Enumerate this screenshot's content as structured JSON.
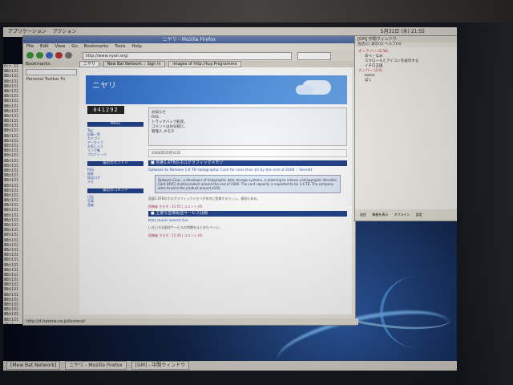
{
  "desktop": {
    "top_menu": [
      "アプリケーション",
      "アクション"
    ],
    "clock": "5月31日 (水) 21:55",
    "taskbar_items": [
      "[Mew Bat Network]",
      "ニヤリ - Mozilla Firefox",
      "[GM] - 中間ウィンドウ"
    ]
  },
  "log_lines": [
    "Oct-31 15:1",
    "Oct-31 15:1",
    "Oct-31 15:1",
    "Oct-31 15:1",
    "Oct-31 15:1",
    "Oct-31 15:1",
    "Oct-31 15:1",
    "Oct-31 15:1",
    "Oct-31 15:1",
    "Oct-31 15:1",
    "Oct-31 15:1",
    "Oct-31 15:1",
    "Oct-31 15:1",
    "Oct-31 15:1",
    "Oct-31 15:1",
    "Oct-31 15:1",
    "Oct-31 15:1",
    "Oct-31 15:1",
    "Oct-31 15:1",
    "Oct-31 15:1",
    "Oct-31 15:1",
    "Oct-31 15:1",
    "Oct-31 15:1",
    "Oct-31 15:1",
    "Oct-31 15:1",
    "Oct-31 15:1",
    "Oct-31 15:1",
    "Oct-31 15:1",
    "Oct-31 15:1",
    "Oct-31 15:1",
    "Oct-31 15:1",
    "Oct-31 15:1",
    "Oct-31 15:1",
    "Oct-31 15:1",
    "Oct-31 15:1",
    "Oct-31 15:1",
    "Oct-31 15:1",
    "Oct-31 15:1",
    "Oct-31 15:1",
    "Oct-31 15:1",
    "Oct-31 15:1",
    "Oct-31 15:1",
    "Oct-31 15:1",
    "Oct-31 15:1",
    "Oct-31 15:1",
    "Oct-31 15:1",
    "Oct-31 15:1",
    "Oct-31 15:1",
    "Oct-31 15:1",
    "Oct-31 15:1",
    "Oct-31 15:1",
    "Oct-31 15:1"
  ],
  "firefox": {
    "window_title": "ニヤリ - Mozilla Firefox",
    "menu": [
      "File",
      "Edit",
      "View",
      "Go",
      "Bookmarks",
      "Tools",
      "Help"
    ],
    "url": "http://www.nyari.org/",
    "sidebar_title": "Bookmarks",
    "sidebar_item": "Personal Toolbar Fo",
    "tabs": [
      "ニヤリ",
      "New Bat Network :: Sign in",
      "images of http://kuy.Programme"
    ],
    "status": "http://d.hatena.ne.jp/kurenai/"
  },
  "site": {
    "name": "ニヤリ",
    "counter": "041292",
    "left_boxes": [
      "Menu",
      "最近のエントリ",
      "最近のコメント"
    ],
    "left_links": [
      "Top",
      "記事一覧",
      "カテゴリ",
      "アーカイブ",
      "お気に入り",
      "リンク集",
      "プロフィール",
      "RSS",
      "検索",
      "過去ログ",
      "メモ",
      "日記",
      "写真",
      "音楽"
    ],
    "notice_lines": [
      "お知らせ",
      "RSS",
      "トラックバック歓迎。",
      "コメントはお気軽に。",
      "管理人 ホモタ"
    ],
    "date": "2006年05月31日",
    "posts": [
      {
        "title": "■ 容量1.6TBのホログラフィックメモリ",
        "link": "Optware to Release 1.6 TB Holographic Card for Less than $5 by the end of 2006 :: Servlet",
        "quote": "Optware Corp., a developer of holographic data storage systems, is planning to release a Holographic Versatile Card (HVC) media product around the end of 2006. The card capacity is expected to be 1.6 TB. The company aims to price the product around $100.",
        "text": "容量1.6TBのホログラフィックメモリが年内に登場するらしい。値段も安め。",
        "meta": "投稿者 ホモタ : 21:55 | コメント (0)"
      },
      {
        "title": "■ 主要な音楽配信サービス比較",
        "link": "itms music search fun",
        "text": "いろいろな配信サービスの特徴をまとめたページ。",
        "meta": "投稿者 ホモタ : 21:30 | コメント (0)"
      }
    ]
  },
  "im": {
    "title": "[GM] 中間ウィンドウ",
    "menu": [
      "会話(C)",
      "表示(V)",
      "ヘルプ(H)"
    ],
    "tree": [
      "オンライン (2/36)",
      "あべ・なみ",
      "スクロールとアイコンを表示する",
      "イチロ王国",
      "メンバー (2/4)",
      "kome",
      "ぼく"
    ],
    "buttons": [
      "送信",
      "情報を表示",
      "オフライン",
      "設定"
    ]
  },
  "colors": {
    "banner": "#2f6fd0",
    "post_title": "#1d3f88",
    "link": "#2a56b8",
    "desktop_glow": "#7fc4ff"
  }
}
